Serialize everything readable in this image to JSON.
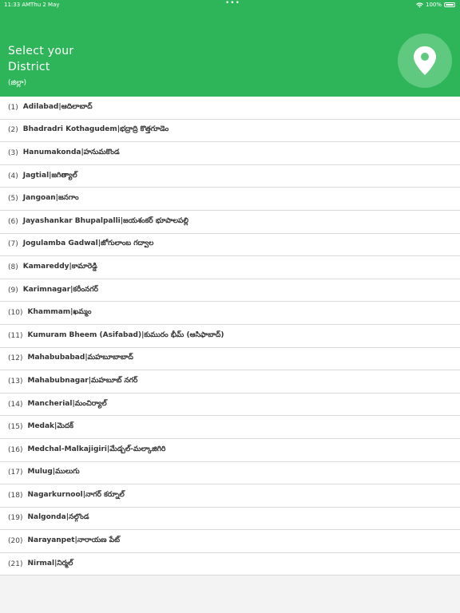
{
  "status": {
    "time": "11:33 AM",
    "date": "Thu 2 May",
    "battery": "100%"
  },
  "header": {
    "title": "Select your District",
    "subtitle": "(జిల్లా)"
  },
  "districts": [
    {
      "index": "(1)",
      "name": "Adilabad|ఆదిలాబాద్"
    },
    {
      "index": "(2)",
      "name": "Bhadradri Kothagudem|భద్రాద్రి కొత్తగూడెం"
    },
    {
      "index": "(3)",
      "name": "Hanumakonda|హనుమకొండ"
    },
    {
      "index": "(4)",
      "name": "Jagtial|జగిత్యాల్"
    },
    {
      "index": "(5)",
      "name": "Jangoan|జనగాం"
    },
    {
      "index": "(6)",
      "name": "Jayashankar Bhupalpalli|జయశంకర్ భూపాలపల్లి"
    },
    {
      "index": "(7)",
      "name": "Jogulamba Gadwal|జోగులాంబ గద్వాల"
    },
    {
      "index": "(8)",
      "name": "Kamareddy|కామారెడ్డి"
    },
    {
      "index": "(9)",
      "name": "Karimnagar|కరీంనగర్"
    },
    {
      "index": "(10)",
      "name": "Khammam|ఖమ్మం"
    },
    {
      "index": "(11)",
      "name": "Kumuram Bheem (Asifabad)|కుమురం భీమ్ (ఆసిఫాబాద్)"
    },
    {
      "index": "(12)",
      "name": "Mahabubabad|మహబూబాబాద్"
    },
    {
      "index": "(13)",
      "name": "Mahabubnagar|మహబూబ్ నగర్"
    },
    {
      "index": "(14)",
      "name": "Mancherial|మంచిర్యాల్"
    },
    {
      "index": "(15)",
      "name": "Medak|మెదక్"
    },
    {
      "index": "(16)",
      "name": "Medchal-Malkajigiri|మేడ్చల్-మల్కాజిగిరి"
    },
    {
      "index": "(17)",
      "name": "Mulug|ములుగు"
    },
    {
      "index": "(18)",
      "name": "Nagarkurnool|నాగర్ కర్నూల్"
    },
    {
      "index": "(19)",
      "name": "Nalgonda|నల్గొండ"
    },
    {
      "index": "(20)",
      "name": "Narayanpet|నారాయణ పేట్"
    },
    {
      "index": "(21)",
      "name": "Nirmal|నిర్మల్"
    }
  ]
}
